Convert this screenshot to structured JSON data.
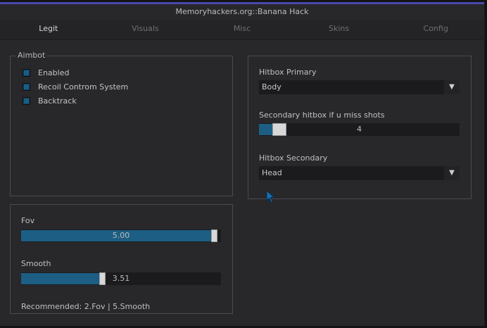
{
  "window": {
    "title": "Memoryhackers.org::Banana Hack",
    "accent_color": "#4b48b0"
  },
  "tabs": [
    {
      "label": "Legit",
      "active": true
    },
    {
      "label": "Visuals",
      "active": false
    },
    {
      "label": "Misc",
      "active": false
    },
    {
      "label": "Skins",
      "active": false
    },
    {
      "label": "Config",
      "active": false
    }
  ],
  "aimbot": {
    "title": "Aimbot",
    "options": [
      {
        "label": "Enabled",
        "checked": true
      },
      {
        "label": "Recoil Controm System",
        "checked": true
      },
      {
        "label": "Backtrack",
        "checked": true
      }
    ]
  },
  "fov_panel": {
    "fov": {
      "label": "Fov",
      "value": "5.00",
      "fraction": 0.97
    },
    "smooth": {
      "label": "Smooth",
      "value": "3.51",
      "fraction": 0.41
    },
    "recommended": "Recommended: 2.Fov | 5.Smooth"
  },
  "hitbox_panel": {
    "primary": {
      "label": "Hitbox Primary",
      "value": "Body"
    },
    "secondary_slider": {
      "label": "Secondary hitbox if u miss shots",
      "value": "4",
      "fraction": 0.1
    },
    "secondary": {
      "label": "Hitbox Secondary",
      "value": "Head"
    }
  },
  "colors": {
    "slider_fill": "#1c5e84",
    "checkbox_fill": "#1a5d86"
  },
  "icons": {
    "dropdown_arrow": "▼",
    "cursor": "cursor-pointer-icon"
  }
}
